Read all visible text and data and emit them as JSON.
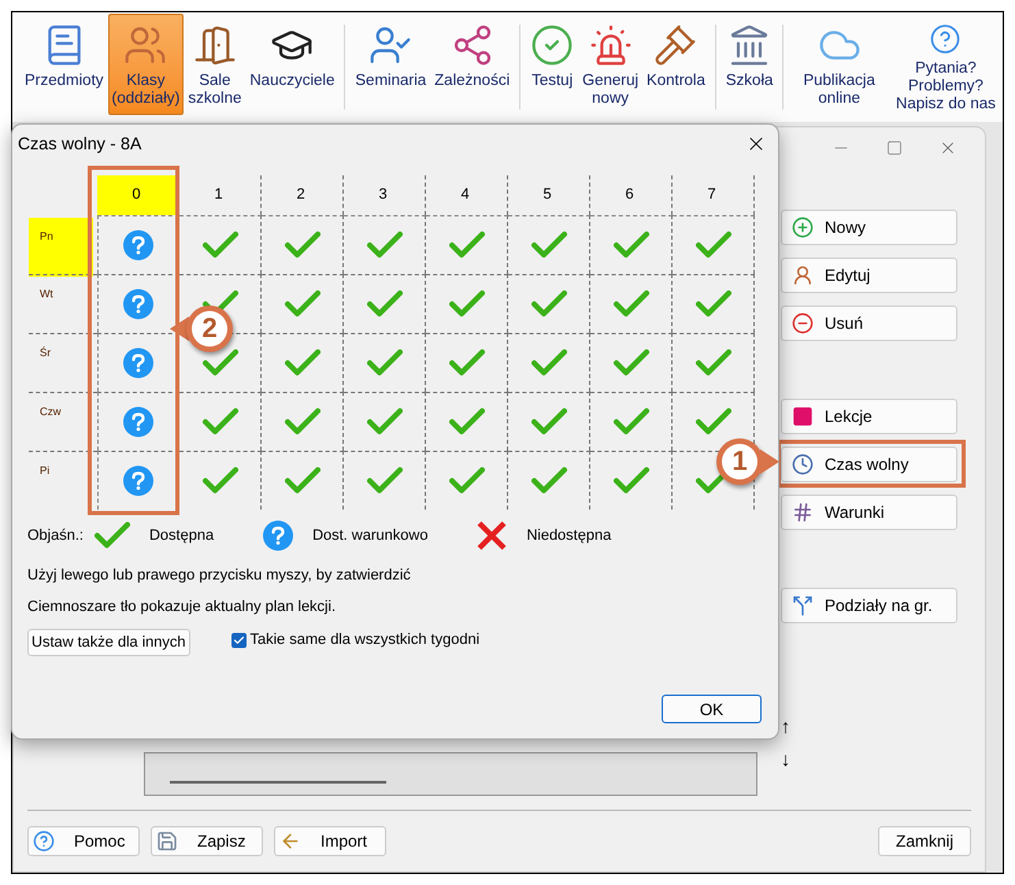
{
  "toolbar": {
    "groups": [
      {
        "items": [
          {
            "label": "Przedmioty",
            "selected": false
          },
          {
            "label": "Klasy (oddziały)",
            "selected": true
          },
          {
            "label": "Sale szkolne",
            "selected": false
          },
          {
            "label": "Nauczyciele",
            "selected": false
          }
        ]
      },
      {
        "items": [
          {
            "label": "Seminaria",
            "selected": false
          },
          {
            "label": "Zależności",
            "selected": false
          }
        ]
      },
      {
        "items": [
          {
            "label": "Testuj",
            "selected": false
          },
          {
            "label": "Generuj nowy",
            "selected": false
          },
          {
            "label": "Kontrola",
            "selected": false
          }
        ]
      },
      {
        "items": [
          {
            "label": "Szkoła",
            "selected": false
          }
        ]
      },
      {
        "items": [
          {
            "label": "Publikacja online",
            "selected": false
          },
          {
            "label": "Pytania? Problemy? Napisz do nas",
            "selected": false
          }
        ]
      }
    ]
  },
  "side_panel": {
    "groups": [
      {
        "buttons": [
          {
            "label": "Nowy",
            "highlighted": false
          },
          {
            "label": "Edytuj",
            "highlighted": false
          },
          {
            "label": "Usuń",
            "highlighted": false
          }
        ]
      },
      {
        "buttons": [
          {
            "label": "Lekcje",
            "highlighted": false
          },
          {
            "label": "Czas wolny",
            "highlighted": true
          },
          {
            "label": "Warunki",
            "highlighted": false
          }
        ]
      },
      {
        "buttons": [
          {
            "label": "Podziały na gr.",
            "highlighted": false
          }
        ]
      }
    ]
  },
  "scroll_arrows": [
    "↑",
    "↓"
  ],
  "bottom_buttons": {
    "left": [
      "Pomoc",
      "Zapisz",
      "Import"
    ],
    "right": "Zamknij"
  },
  "dialog": {
    "title": "Czas wolny - 8A",
    "columns": [
      {
        "label": "0",
        "highlighted": true
      },
      {
        "label": "1",
        "highlighted": false
      },
      {
        "label": "2",
        "highlighted": false
      },
      {
        "label": "3",
        "highlighted": false
      },
      {
        "label": "4",
        "highlighted": false
      },
      {
        "label": "5",
        "highlighted": false
      },
      {
        "label": "6",
        "highlighted": false
      },
      {
        "label": "7",
        "highlighted": false
      }
    ],
    "rows": [
      {
        "label": "Pn",
        "highlighted": true,
        "cells": [
          {
            "kind": "conditional"
          },
          {
            "kind": "available"
          },
          {
            "kind": "available"
          },
          {
            "kind": "available"
          },
          {
            "kind": "available"
          },
          {
            "kind": "available"
          },
          {
            "kind": "available"
          },
          {
            "kind": "available"
          }
        ]
      },
      {
        "label": "Wt",
        "highlighted": false,
        "cells": [
          {
            "kind": "conditional"
          },
          {
            "kind": "available"
          },
          {
            "kind": "available"
          },
          {
            "kind": "available"
          },
          {
            "kind": "available"
          },
          {
            "kind": "available"
          },
          {
            "kind": "available"
          },
          {
            "kind": "available"
          }
        ]
      },
      {
        "label": "Śr",
        "highlighted": false,
        "cells": [
          {
            "kind": "conditional"
          },
          {
            "kind": "available"
          },
          {
            "kind": "available"
          },
          {
            "kind": "available"
          },
          {
            "kind": "available"
          },
          {
            "kind": "available"
          },
          {
            "kind": "available"
          },
          {
            "kind": "available"
          }
        ]
      },
      {
        "label": "Czw",
        "highlighted": false,
        "cells": [
          {
            "kind": "conditional"
          },
          {
            "kind": "available"
          },
          {
            "kind": "available"
          },
          {
            "kind": "available"
          },
          {
            "kind": "available"
          },
          {
            "kind": "available"
          },
          {
            "kind": "available"
          },
          {
            "kind": "available"
          }
        ]
      },
      {
        "label": "Pi",
        "highlighted": false,
        "cells": [
          {
            "kind": "conditional"
          },
          {
            "kind": "available"
          },
          {
            "kind": "available"
          },
          {
            "kind": "available"
          },
          {
            "kind": "available"
          },
          {
            "kind": "available"
          },
          {
            "kind": "available"
          },
          {
            "kind": "available"
          }
        ]
      }
    ],
    "legend_label": "Objaśn.:",
    "legend": [
      {
        "kind": "available",
        "label": "Dostępna"
      },
      {
        "kind": "conditional",
        "label": "Dost. warunkowo"
      },
      {
        "kind": "unavailable",
        "label": "Niedostępna"
      }
    ],
    "hints": [
      "Użyj lewego lub prawego przycisku myszy, by zatwierdzić",
      "Ciemnoszare tło pokazuje aktualny plan lekcji."
    ],
    "set_for_others_button": "Ustaw także dla innych",
    "same_all_weeks": {
      "label": "Takie same dla wszystkich tygodni",
      "checked": true
    },
    "ok_button": "OK"
  },
  "callouts": [
    {
      "label": "1"
    },
    {
      "label": "2"
    }
  ]
}
